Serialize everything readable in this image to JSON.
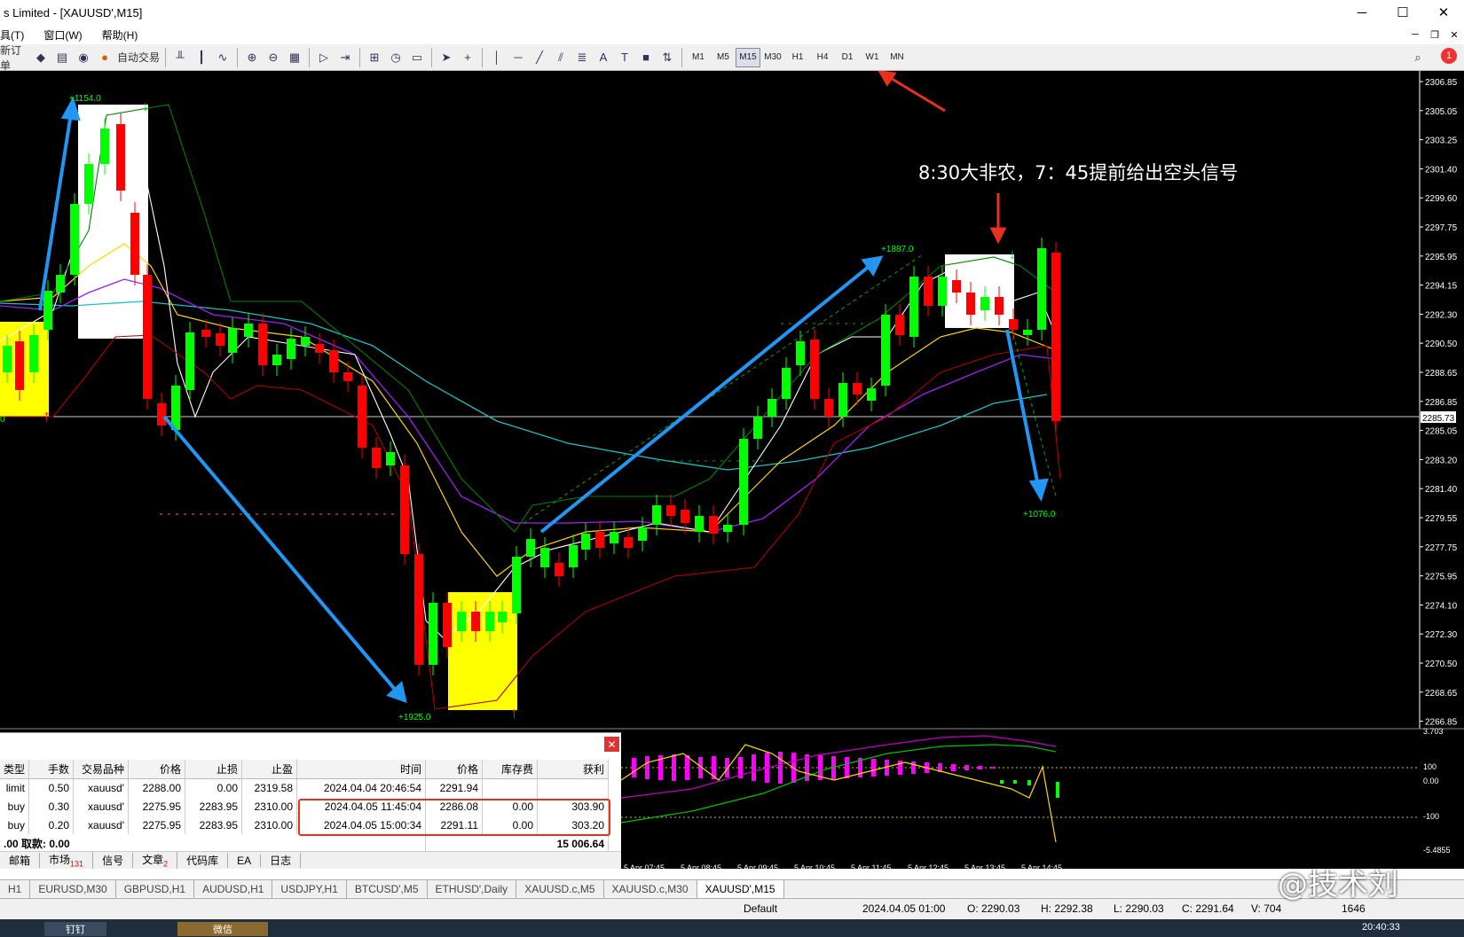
{
  "window": {
    "title": "s Limited - [XAUUSD',M15]",
    "minimize": "─",
    "maximize": "☐",
    "close": "✕"
  },
  "menu": {
    "items": [
      "具(T)",
      "窗口(W)",
      "帮助(H)"
    ]
  },
  "mdi": {
    "minimize": "─",
    "restore": "❐",
    "close": "✕"
  },
  "toolbar": {
    "new_order": "新订单",
    "auto_trade": "自动交易",
    "timeframes": [
      "M1",
      "M5",
      "M15",
      "M30",
      "H1",
      "H4",
      "D1",
      "W1",
      "MN"
    ],
    "active_tf": "M15",
    "alert_count": "1"
  },
  "chart": {
    "symbol": "XAUUSD',M15",
    "annotation": "8:30大非农，7：45提前给出空头信号",
    "price_scale": [
      "2306.85",
      "2305.05",
      "2303.25",
      "2301.40",
      "2299.60",
      "2297.75",
      "2295.95",
      "2294.15",
      "2292.30",
      "2290.50",
      "2288.65",
      "2286.85",
      "2285.05",
      "2283.20",
      "2281.40",
      "2279.55",
      "2277.75",
      "2275.95",
      "2274.10",
      "2272.30",
      "2270.50",
      "2268.65",
      "2266.85"
    ],
    "current_price": "2285.73",
    "labels": {
      "top_left": "+1154.0",
      "mid": "+1887.0",
      "bottom": "+1925.0",
      "right": "+1076.0",
      "left_edge": "0"
    },
    "time_axis": [
      "5 Apr 07:45",
      "5 Apr 08:45",
      "5 Apr 09:45",
      "5 Apr 10:45",
      "5 Apr 11:45",
      "5 Apr 12:45",
      "5 Apr 13:45",
      "5 Apr 14:45"
    ],
    "osc_scale": [
      "3.703",
      "100",
      "0.00",
      "-100",
      "-5.4855"
    ]
  },
  "terminal": {
    "headers": [
      "类型",
      "手数",
      "交易品种",
      "价格",
      "止损",
      "止盈",
      "时间",
      "价格",
      "库存费",
      "获利"
    ],
    "rows": [
      [
        "limit",
        "0.50",
        "xauusd'",
        "2288.00",
        "0.00",
        "2319.58",
        "2024.04.04 20:46:54",
        "2291.94",
        "",
        ""
      ],
      [
        "buy",
        "0.30",
        "xauusd'",
        "2275.95",
        "2283.95",
        "2310.00",
        "2024.04.05 11:45:04",
        "2286.08",
        "0.00",
        "303.90"
      ],
      [
        "buy",
        "0.20",
        "xauusd'",
        "2275.95",
        "2283.95",
        "2310.00",
        "2024.04.05 15:00:34",
        "2291.11",
        "0.00",
        "303.20"
      ]
    ],
    "footer_left": ".00  取款: 0.00",
    "footer_right": "15 006.64",
    "tabs": [
      "邮箱",
      "市场",
      "信号",
      "文章",
      "代码库",
      "EA",
      "日志"
    ],
    "market_badge": "131",
    "article_badge": "2"
  },
  "chart_tabs": [
    "H1",
    "EURUSD,M30",
    "GBPUSD,H1",
    "AUDUSD,H1",
    "USDJPY,H1",
    "BTCUSD',M5",
    "ETHUSD',Daily",
    "XAUUSD.c,M5",
    "XAUUSD.c,M30",
    "XAUUSD',M15"
  ],
  "status": {
    "profile": "Default",
    "time": "2024.04.05 01:00",
    "open": "O: 2290.03",
    "high": "H: 2292.38",
    "low": "L: 2290.03",
    "close": "C: 2291.64",
    "volume": "V: 704",
    "kb": "1646"
  },
  "taskbar": {
    "app1": "钉钉",
    "app2": "微信",
    "clock": "20:40:33"
  },
  "watermark": "@技术刘",
  "colors": {
    "bull": "#00ff00",
    "bear": "#ff0000",
    "bg": "#000000",
    "arrow": "#2196f3"
  }
}
